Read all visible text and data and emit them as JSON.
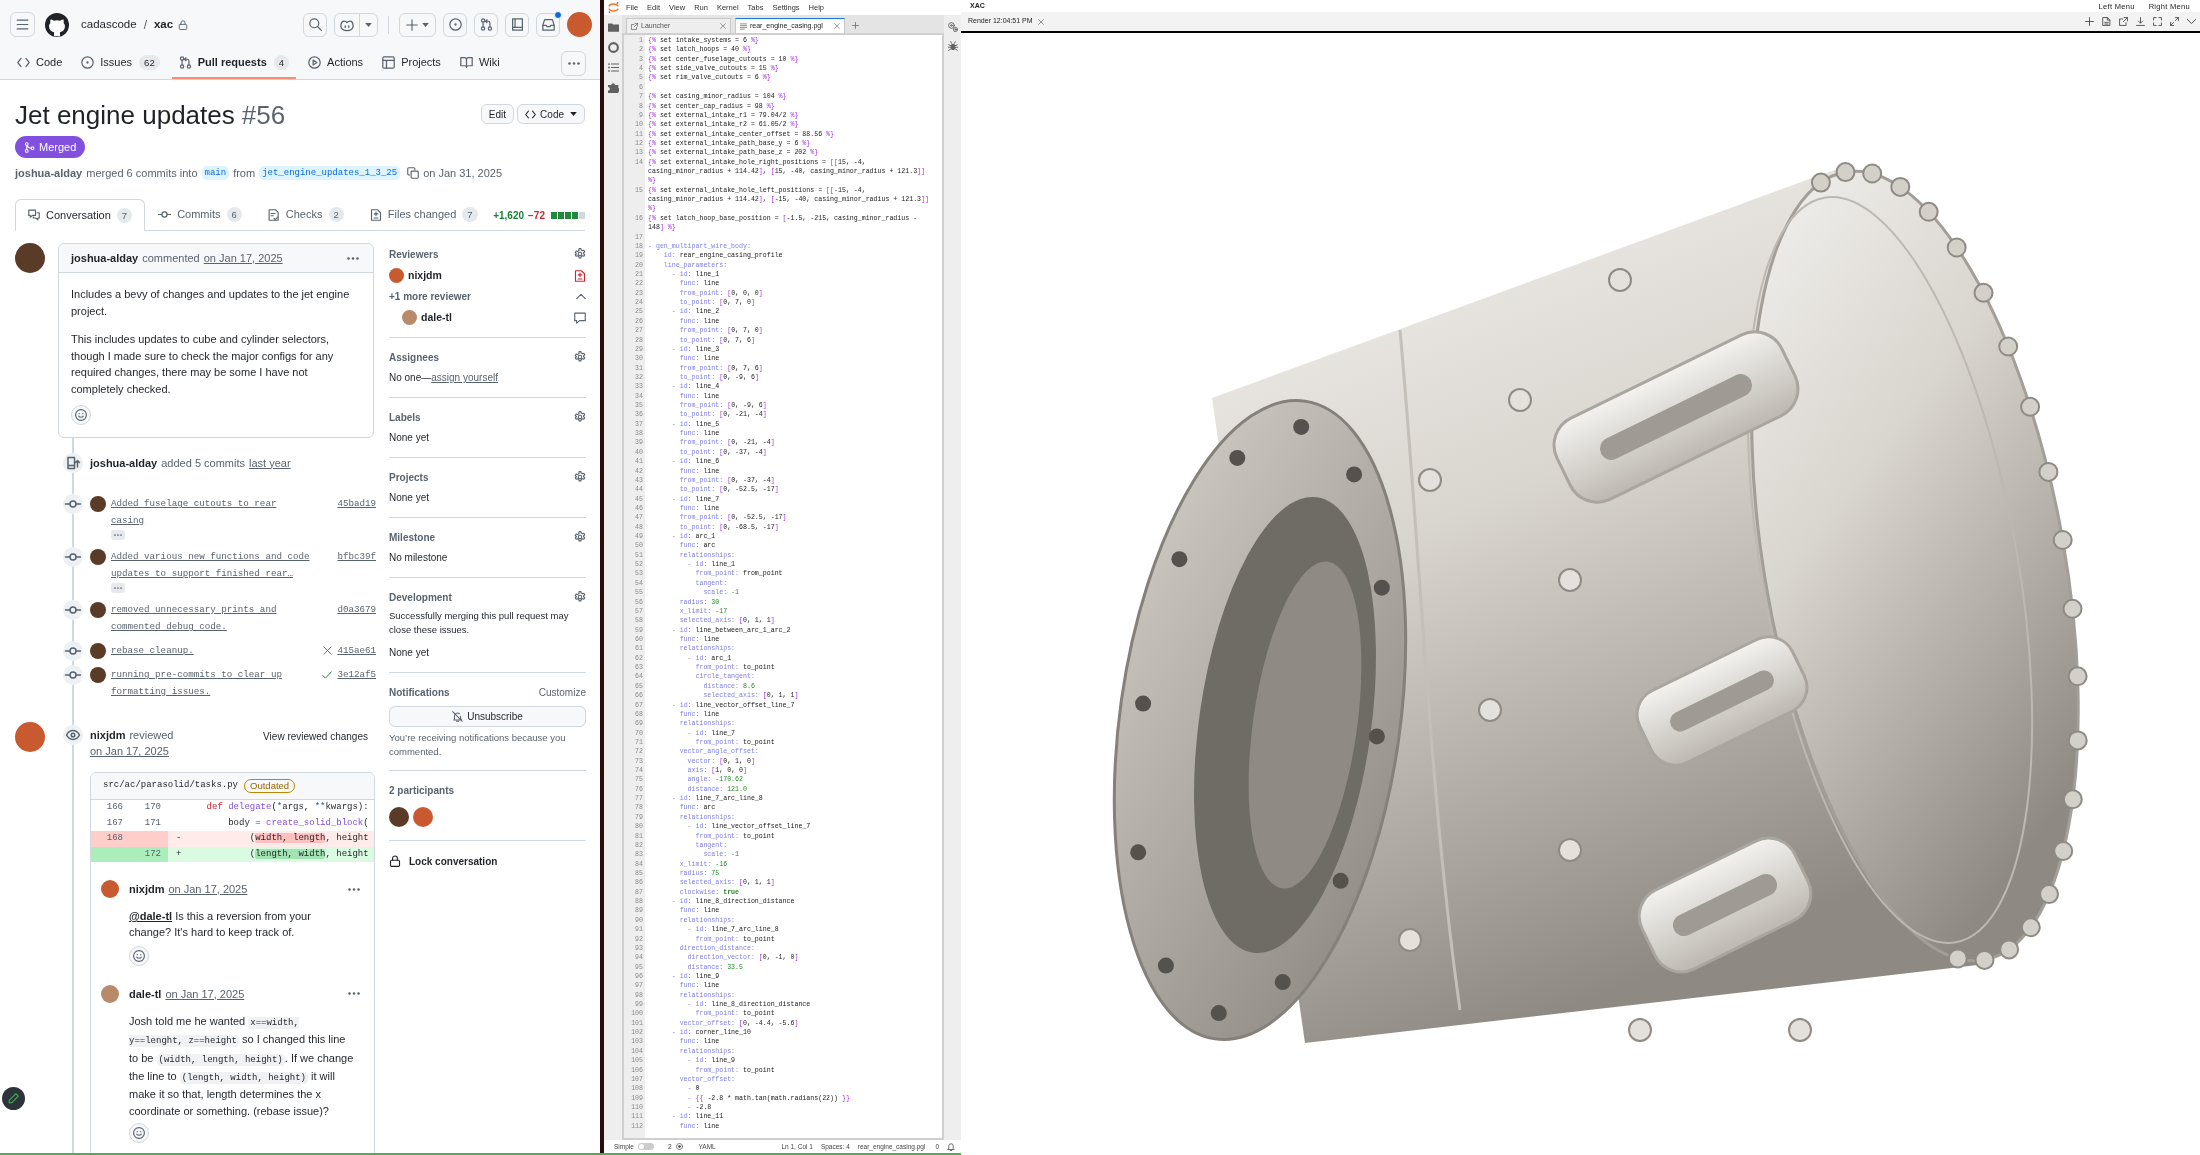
{
  "github": {
    "header": {
      "owner": "cadascode",
      "separator": "/",
      "repo": "xac",
      "private": true,
      "notifications_unread": true
    },
    "repo_nav": [
      {
        "kind": "code",
        "label": "Code",
        "selected": false
      },
      {
        "kind": "issues",
        "label": "Issues",
        "count": "62",
        "selected": false
      },
      {
        "kind": "pulls",
        "label": "Pull requests",
        "count": "4",
        "selected": true
      },
      {
        "kind": "actions",
        "label": "Actions",
        "selected": false
      },
      {
        "kind": "projects",
        "label": "Projects",
        "selected": false
      },
      {
        "kind": "wiki",
        "label": "Wiki",
        "selected": false
      }
    ],
    "pull_request": {
      "title": "Jet engine updates",
      "number": "#56",
      "buttons": [
        {
          "kind": "edit",
          "label": "Edit"
        },
        {
          "kind": "code",
          "label": "Code"
        }
      ],
      "status": {
        "kind": "merged",
        "label": "Merged"
      },
      "summary": {
        "author": "joshua-alday",
        "action": "merged 6 commits into",
        "base_branch": "main",
        "joiner": "from",
        "head_branch": "jet_engine_updates_1_3_25",
        "date": "on Jan 31, 2025"
      }
    },
    "tabs": [
      {
        "kind": "conversation",
        "label": "Conversation",
        "count": "7",
        "selected": true
      },
      {
        "kind": "commits",
        "label": "Commits",
        "count": "6",
        "selected": false
      },
      {
        "kind": "checks",
        "label": "Checks",
        "count": "2",
        "selected": false
      },
      {
        "kind": "files",
        "label": "Files changed",
        "count": "7",
        "selected": false
      }
    ],
    "diffstat": {
      "additions": "+1,620",
      "deletions": "−72",
      "blocks": [
        {
          "kind": "added"
        },
        {
          "kind": "added"
        },
        {
          "kind": "added"
        },
        {
          "kind": "added"
        },
        {
          "kind": "neutral"
        }
      ]
    },
    "timeline": [
      {
        "kind": "comment",
        "author": "joshua-alday",
        "action": "commented",
        "date": "on Jan 17, 2025",
        "paragraphs": [
          "Includes a bevy of changes and updates to the jet engine project.",
          "This includes updates to cube and cylinder selectors, though I made sure to check the major configs for any required changes, there may be some I have not completely checked."
        ]
      },
      {
        "kind": "commits",
        "author": "joshua-alday",
        "action": "added 5 commits",
        "time": "last year",
        "commits": [
          {
            "kind": "plain",
            "message": "Added fuselage cutouts to rear casing",
            "hash": "45bad19",
            "expandable": true
          },
          {
            "kind": "plain",
            "message": "Added various new functions and code updates to support finished rear…",
            "hash": "bfbc39f",
            "expandable": true
          },
          {
            "kind": "plain",
            "message": "removed unnecessary prints and commented debug code.",
            "hash": "d0a3679",
            "expandable": false
          },
          {
            "kind": "failed",
            "message": "rebase cleanup.",
            "hash": "415ae61",
            "expandable": false
          },
          {
            "kind": "passed",
            "message": "running pre-commits to clear up formatting issues.",
            "hash": "3e12af5",
            "expandable": false
          }
        ]
      },
      {
        "kind": "review",
        "author": "nixjdm",
        "action": "reviewed",
        "date": "on Jan 17, 2025",
        "view_button": "View reviewed changes",
        "file": {
          "path": "src/ac/parasolid/tasks.py",
          "badge": "Outdated",
          "rows": [
            {
              "kind": "context",
              "old": "166",
              "new": "170",
              "code": [
                {
                  "kind": "keyword",
                  "text": "    def"
                },
                {
                  "kind": "function",
                  "text": " delegate"
                },
                {
                  "kind": "plain",
                  "text": "("
                },
                {
                  "kind": "operator",
                  "text": "*"
                },
                {
                  "kind": "plain",
                  "text": "args, "
                },
                {
                  "kind": "operator",
                  "text": "**"
                },
                {
                  "kind": "plain",
                  "text": "kwargs):"
                }
              ]
            },
            {
              "kind": "context",
              "old": "167",
              "new": "171",
              "code": [
                {
                  "kind": "plain",
                  "text": "        body "
                },
                {
                  "kind": "operator",
                  "text": "="
                },
                {
                  "kind": "function",
                  "text": " create_solid_block"
                },
                {
                  "kind": "plain",
                  "text": "("
                }
              ]
            },
            {
              "kind": "deletion",
              "old": "168",
              "marker": "-",
              "code": [
                {
                  "kind": "plain",
                  "text": "            ("
                },
                {
                  "kind": "changed",
                  "text": "width, length"
                },
                {
                  "kind": "plain",
                  "text": ", height"
                }
              ]
            },
            {
              "kind": "addition",
              "new": "172",
              "marker": "+",
              "code": [
                {
                  "kind": "plain",
                  "text": "            ("
                },
                {
                  "kind": "changed",
                  "text": "length, width"
                },
                {
                  "kind": "plain",
                  "text": ", height"
                }
              ]
            }
          ]
        },
        "comments": [
          {
            "author": "nixjdm",
            "date": "on Jan 17, 2025",
            "segments": [
              {
                "kind": "mention",
                "text": "@dale-tl"
              },
              {
                "kind": "text",
                "text": " Is this a reversion from your change? It's hard to keep track of."
              }
            ]
          },
          {
            "author": "dale-tl",
            "date": "on Jan 17, 2025",
            "segments": [
              {
                "kind": "text",
                "text": "Josh told me he wanted "
              },
              {
                "kind": "code",
                "text": "x==width, y==lenght, z==height"
              },
              {
                "kind": "text",
                "text": " so I changed this line to be "
              },
              {
                "kind": "code",
                "text": "(width, length, height)"
              },
              {
                "kind": "text",
                "text": ". If we change the line to "
              },
              {
                "kind": "code",
                "text": "(length, width, height)"
              },
              {
                "kind": "text",
                "text": " it will make it so that, length determines the x coordinate or something. (rebase issue)?"
              }
            ]
          }
        ]
      }
    ],
    "sidebar": {
      "reviewers": {
        "title": "Reviewers",
        "items": [
          {
            "name": "nixjdm",
            "kind": "changes_requested"
          }
        ],
        "more": {
          "label": "+1 more reviewer",
          "expanded": true,
          "items": [
            {
              "name": "dale-tl",
              "kind": "commented"
            }
          ]
        }
      },
      "assignees": {
        "title": "Assignees",
        "empty_text": "No one—",
        "action_link": "assign yourself"
      },
      "labels": {
        "title": "Labels",
        "value": "None yet"
      },
      "projects": {
        "title": "Projects",
        "value": "None yet"
      },
      "milestone": {
        "title": "Milestone",
        "value": "No milestone"
      },
      "development": {
        "title": "Development",
        "note": "Successfully merging this pull request may close these issues.",
        "value": "None yet"
      },
      "notifications": {
        "title": "Notifications",
        "customize": "Customize",
        "button": "Unsubscribe",
        "reason": "You’re receiving notifications because you commented."
      },
      "participants": {
        "title": "2 participants",
        "avatars": [
          {
            "color": "#5a3b28"
          },
          {
            "color": "#c9592f"
          }
        ]
      },
      "lock": {
        "label": "Lock conversation"
      }
    }
  },
  "editor": {
    "menu": [
      "File",
      "Edit",
      "View",
      "Run",
      "Kernel",
      "Tabs",
      "Settings",
      "Help"
    ],
    "tabs": [
      {
        "kind": "launcher",
        "label": "Launcher",
        "selected": false
      },
      {
        "kind": "file",
        "label": "rear_engine_casing.pgl",
        "selected": true
      }
    ],
    "lines": [
      {
        "number": "1",
        "text": "{% set intake_systems = 6 %}"
      },
      {
        "number": "2",
        "text": "{% set latch_hoops = 40 %}"
      },
      {
        "number": "3",
        "text": "{% set center_fuselage_cutouts = 10 %}"
      },
      {
        "number": "4",
        "text": "{% set side_valve_cutouts = 15 %}"
      },
      {
        "number": "5",
        "text": "{% set rim_valve_cutouts = 6 %}"
      },
      {
        "number": "6"
      },
      {
        "number": "7",
        "text": "{% set casing_minor_radius = 104 %}"
      },
      {
        "number": "8",
        "text": "{% set center_cap_radius = 98 %}"
      },
      {
        "number": "9",
        "text": "{% set external_intake_r1 = 79.04/2 %}"
      },
      {
        "number": "10",
        "text": "{% set external_intake_r2 = 61.05/2 %}"
      },
      {
        "number": "11",
        "text": "{% set external_intake_center_offset = 88.56 %}"
      },
      {
        "number": "12",
        "text": "{% set external_intake_path_base_y = 6 %}"
      },
      {
        "number": "13",
        "text": "{% set external_intake_path_base_z = 202 %}"
      },
      {
        "number": "14",
        "text": "{% set external_intake_hole_right_positions = [[15, -4, casing_minor_radius + 114.42], [15, -40, casing_minor_radius + 121.3]] %}"
      },
      {
        "number": "15",
        "text": "{% set external_intake_hole_left_positions = [[-15, -4, casing_minor_radius + 114.42], [-15, -40, casing_minor_radius + 121.3]] %}"
      },
      {
        "number": "16",
        "text": "{% set latch_hoop_base_position = [-1.5, -215, casing_minor_radius - 148] %}"
      },
      {
        "number": "17"
      },
      {
        "number": "18",
        "text": "- gen_multipart_wire_body:"
      },
      {
        "number": "19",
        "text": "    id: rear_engine_casing_profile"
      },
      {
        "number": "20",
        "text": "    line_parameters:"
      },
      {
        "number": "21",
        "text": "      - id: line_1"
      },
      {
        "number": "22",
        "text": "        func: line"
      },
      {
        "number": "23",
        "text": "        from_point: [0, 0, 0]"
      },
      {
        "number": "24",
        "text": "        to_point: [0, 7, 0]"
      },
      {
        "number": "25",
        "text": "      - id: line_2"
      },
      {
        "number": "26",
        "text": "        func: line"
      },
      {
        "number": "27",
        "text": "        from_point: [0, 7, 0]"
      },
      {
        "number": "28",
        "text": "        to_point: [0, 7, 6]"
      },
      {
        "number": "29",
        "text": "      - id: line_3"
      },
      {
        "number": "30",
        "text": "        func: line"
      },
      {
        "number": "31",
        "text": "        from_point: [0, 7, 6]"
      },
      {
        "number": "32",
        "text": "        to_point: [0, -9, 6]"
      },
      {
        "number": "33",
        "text": "      - id: line_4"
      },
      {
        "number": "34",
        "text": "        func: line"
      },
      {
        "number": "35",
        "text": "        from_point: [0, -9, 6]"
      },
      {
        "number": "36",
        "text": "        to_point: [0, -21, -4]"
      },
      {
        "number": "37",
        "text": "      - id: line_5"
      },
      {
        "number": "38",
        "text": "        func: line"
      },
      {
        "number": "39",
        "text": "        from_point: [0, -21, -4]"
      },
      {
        "number": "40",
        "text": "        to_point: [0, -37, -4]"
      },
      {
        "number": "41",
        "text": "      - id: line_6"
      },
      {
        "number": "42",
        "text": "        func: line"
      },
      {
        "number": "43",
        "text": "        from_point: [0, -37, -4]"
      },
      {
        "number": "44",
        "text": "        to_point: [0, -52.5, -17]"
      },
      {
        "number": "45",
        "text": "      - id: line_7"
      },
      {
        "number": "46",
        "text": "        func: line"
      },
      {
        "number": "47",
        "text": "        from_point: [0, -52.5, -17]"
      },
      {
        "number": "48",
        "text": "        to_point: [0, -68.5, -17]"
      },
      {
        "number": "49",
        "text": "      - id: arc_1"
      },
      {
        "number": "50",
        "text": "        func: arc"
      },
      {
        "number": "51",
        "text": "        relationships:"
      },
      {
        "number": "52",
        "text": "          - id: line_1"
      },
      {
        "number": "53",
        "text": "            from_point: from_point"
      },
      {
        "number": "54",
        "text": "            tangent:"
      },
      {
        "number": "55",
        "text": "              scale: -1"
      },
      {
        "number": "56",
        "text": "        radius: 30"
      },
      {
        "number": "57",
        "text": "        x_limit: -17"
      },
      {
        "number": "58",
        "text": "        selected_axis: [0, 1, 1]"
      },
      {
        "number": "59",
        "text": "      - id: line_between_arc_1_arc_2"
      },
      {
        "number": "60",
        "text": "        func: line"
      },
      {
        "number": "61",
        "text": "        relationships:"
      },
      {
        "number": "62",
        "text": "          - id: arc_1"
      },
      {
        "number": "63",
        "text": "            from_point: to_point"
      },
      {
        "number": "64",
        "text": "            circle_tangent:"
      },
      {
        "number": "65",
        "text": "              distance: 8.6"
      },
      {
        "number": "66",
        "text": "              selected_axis: [0, 1, 1]"
      },
      {
        "number": "67",
        "text": "      - id: line_vector_offset_line_7"
      },
      {
        "number": "68",
        "text": "        func: line"
      },
      {
        "number": "69",
        "text": "        relationships:"
      },
      {
        "number": "70",
        "text": "          - id: line_7"
      },
      {
        "number": "71",
        "text": "            from_point: to_point"
      },
      {
        "number": "72",
        "text": "        vector_angle_offset:"
      },
      {
        "number": "73",
        "text": "          vector: [0, 1, 0]"
      },
      {
        "number": "74",
        "text": "          axis: [1, 0, 0]"
      },
      {
        "number": "75",
        "text": "          angle: -170.62"
      },
      {
        "number": "76",
        "text": "          distance: 121.0"
      },
      {
        "number": "77",
        "text": "      - id: line_7_arc_line_8"
      },
      {
        "number": "78",
        "text": "        func: arc"
      },
      {
        "number": "79",
        "text": "        relationships:"
      },
      {
        "number": "80",
        "text": "          - id: line_vector_offset_line_7"
      },
      {
        "number": "81",
        "text": "            from_point: to_point"
      },
      {
        "number": "82",
        "text": "            tangent:"
      },
      {
        "number": "83",
        "text": "              scale: -1"
      },
      {
        "number": "84",
        "text": "        x_limit: -16"
      },
      {
        "number": "85",
        "text": "        radius: 75"
      },
      {
        "number": "86",
        "text": "        selected_axis: [0, 1, 1]"
      },
      {
        "number": "87",
        "text": "        clockwise: true"
      },
      {
        "number": "88",
        "text": "      - id: line_8_direction_distance"
      },
      {
        "number": "89",
        "text": "        func: line"
      },
      {
        "number": "90",
        "text": "        relationships:"
      },
      {
        "number": "91",
        "text": "          - id: line_7_arc_line_8"
      },
      {
        "number": "92",
        "text": "            from_point: to_point"
      },
      {
        "number": "93",
        "text": "        direction_distance:"
      },
      {
        "number": "94",
        "text": "          direction_vector: [0, -1, 0]"
      },
      {
        "number": "95",
        "text": "          distance: 33.5"
      },
      {
        "number": "96",
        "text": "      - id: line_9"
      },
      {
        "number": "97",
        "text": "        func: line"
      },
      {
        "number": "98",
        "text": "        relationships:"
      },
      {
        "number": "99",
        "text": "          - id: line_8_direction_distance"
      },
      {
        "number": "100",
        "text": "            from_point: to_point"
      },
      {
        "number": "101",
        "text": "        vector_offset: [0, -4.4, -5.6]"
      },
      {
        "number": "102",
        "text": "      - id: corner_line_10"
      },
      {
        "number": "103",
        "text": "        func: line"
      },
      {
        "number": "104",
        "text": "        relationships:"
      },
      {
        "number": "105",
        "text": "          - id: line_9"
      },
      {
        "number": "106",
        "text": "            from_point: to_point"
      },
      {
        "number": "107",
        "text": "        vector_offset:"
      },
      {
        "number": "108",
        "text": "          - 0"
      },
      {
        "number": "109",
        "text": "          - {{ -2.8 * math.tan(math.radians(22)) }}"
      },
      {
        "number": "110",
        "text": "          - -2.8"
      },
      {
        "number": "111",
        "text": "      - id: line_11"
      },
      {
        "number": "112",
        "text": "        func: line"
      }
    ],
    "status": {
      "mode": {
        "label": "Simple",
        "on": false
      },
      "terminals": "2",
      "language": "YAML",
      "cursor": "Ln 1, Col 1",
      "indent": "Spaces: 4",
      "file": "rear_engine_casing.pgl",
      "notifications": "0"
    }
  },
  "viewer": {
    "app_title": "XAC",
    "menus": [
      "Left Menu",
      "Right Menu"
    ],
    "tab": {
      "label": "Render 12:04:51 PM"
    }
  }
}
